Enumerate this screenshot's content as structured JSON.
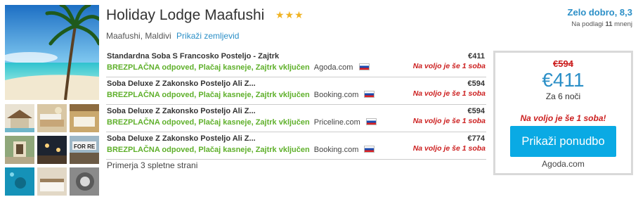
{
  "hotel": {
    "name": "Holiday Lodge Maafushi",
    "stars": "★★★",
    "location": "Maafushi, Maldivi",
    "map_link": "Prikaži zemljevid"
  },
  "rating": {
    "score_text": "Zelo dobro, 8,3",
    "reviews_prefix": "Na podlagi",
    "reviews_count": "11",
    "reviews_suffix": "mnenj"
  },
  "offers": [
    {
      "title": "Standardna Soba S Francosko Posteljo - Zajtrk",
      "features": "BREZPLAČNA odpoved, Plačaj kasneje, Zajtrk vključen",
      "site": "Agoda.com",
      "price": "€411",
      "availability": "Na voljo je še 1 soba"
    },
    {
      "title": "Soba Deluxe Z Zakonsko Posteljo Ali Z...",
      "features": "BREZPLAČNA odpoved, Plačaj kasneje, Zajtrk vključen",
      "site": "Booking.com",
      "price": "€594",
      "availability": "Na voljo je še 1 soba"
    },
    {
      "title": "Soba Deluxe Z Zakonsko Posteljo Ali Z...",
      "features": "BREZPLAČNA odpoved, Plačaj kasneje, Zajtrk vključen",
      "site": "Priceline.com",
      "price": "€594",
      "availability": "Na voljo je še 1 soba"
    },
    {
      "title": "Soba Deluxe Z Zakonsko Posteljo Ali Z...",
      "features": "BREZPLAČNA odpoved, Plačaj kasneje, Zajtrk vključen",
      "site": "Booking.com",
      "price": "€774",
      "availability": "Na voljo je še 1 soba"
    }
  ],
  "compare_text": "Primerja 3 spletne strani",
  "price_box": {
    "old_price": "€594",
    "new_price": "€411",
    "nights": "Za 6 noči",
    "availability": "Na voljo je še 1 soba!",
    "button_label": "Prikaži ponudbo",
    "site": "Agoda.com"
  },
  "colors": {
    "accent_blue": "#2b8fc7",
    "button_blue": "#0aaae4",
    "green": "#5fb02b",
    "red": "#cc1f1f",
    "star": "#f0b323"
  },
  "icons": [
    "slovenia-flag-icon",
    "star-icon"
  ]
}
